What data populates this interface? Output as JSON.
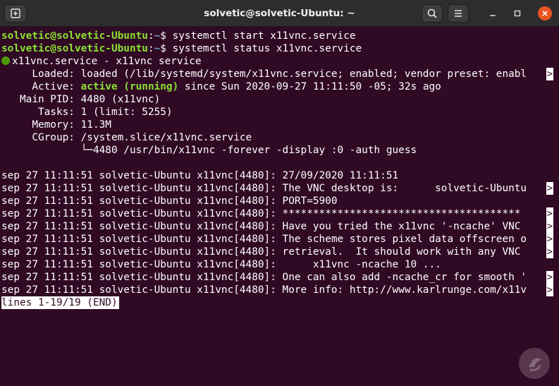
{
  "window": {
    "title": "solvetic@solvetic-Ubuntu: ~",
    "icons": {
      "new_tab": "new-tab-icon",
      "search": "search-icon",
      "menu": "hamburger-menu-icon",
      "minimize": "minimize-icon",
      "maximize": "maximize-icon",
      "close": "close-icon"
    },
    "accent_close": "#e95420"
  },
  "terminal": {
    "colors": {
      "background": "#300a24",
      "prompt_user": "#8ae234",
      "prompt_path": "#729fcf",
      "active": "#8ae234",
      "text": "#ffffff"
    },
    "commands": [
      {
        "user": "solvetic@solvetic-Ubuntu",
        "sep": ":",
        "path": "~",
        "symbol": "$ ",
        "cmd": "systemctl start x11vnc.service"
      },
      {
        "user": "solvetic@solvetic-Ubuntu",
        "sep": ":",
        "path": "~",
        "symbol": "$ ",
        "cmd": "systemctl status x11vnc.service"
      }
    ],
    "service_header": "x11vnc.service - x11vnc service",
    "loaded": "     Loaded: loaded (/lib/systemd/system/x11vnc.service; enabled; vendor preset: enabl",
    "active_label": "     Active: ",
    "active_state": "active (running)",
    "active_rest": " since Sun 2020-09-27 11:11:50 -05; 32s ago",
    "main_pid": "   Main PID: 4480 (x11vnc)",
    "tasks": "      Tasks: 1 (limit: 5255)",
    "memory": "     Memory: 11.3M",
    "cgroup": "     CGroup: /system.slice/x11vnc.service",
    "cgroup_child": "             └─4480 /usr/bin/x11vnc -forever -display :0 -auth guess",
    "log_lines": [
      "sep 27 11:11:51 solvetic-Ubuntu x11vnc[4480]: 27/09/2020 11:11:51",
      "sep 27 11:11:51 solvetic-Ubuntu x11vnc[4480]: The VNC desktop is:      solvetic-Ubuntu",
      "sep 27 11:11:51 solvetic-Ubuntu x11vnc[4480]: PORT=5900",
      "sep 27 11:11:51 solvetic-Ubuntu x11vnc[4480]: ***************************************",
      "sep 27 11:11:51 solvetic-Ubuntu x11vnc[4480]: Have you tried the x11vnc '-ncache' VNC ",
      "sep 27 11:11:51 solvetic-Ubuntu x11vnc[4480]: The scheme stores pixel data offscreen o",
      "sep 27 11:11:51 solvetic-Ubuntu x11vnc[4480]: retrieval.  It should work with any VNC ",
      "sep 27 11:11:51 solvetic-Ubuntu x11vnc[4480]:      x11vnc -ncache 10 ...",
      "sep 27 11:11:51 solvetic-Ubuntu x11vnc[4480]: One can also add -ncache_cr for smooth '",
      "sep 27 11:11:51 solvetic-Ubuntu x11vnc[4480]: More info: http://www.karlrunge.com/x11v"
    ],
    "truncation_marker": ">",
    "pager_status": "lines 1-19/19 (END)"
  }
}
